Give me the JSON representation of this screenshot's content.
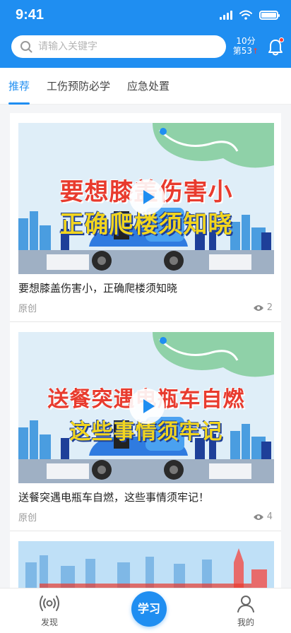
{
  "status": {
    "time": "9:41"
  },
  "header": {
    "search_placeholder": "请输入关键字",
    "score_line1": "10分",
    "score_line2": "第53",
    "score_arrow": "↑"
  },
  "tabs": [
    {
      "label": "推荐",
      "active": true
    },
    {
      "label": "工伤预防必学",
      "active": false
    },
    {
      "label": "应急处置",
      "active": false
    }
  ],
  "feed": [
    {
      "overlay_line1": "要想膝盖伤害小",
      "overlay_line2": "正确爬楼须知晓",
      "title": "要想膝盖伤害小，正确爬楼须知晓",
      "source": "原创",
      "views": "2"
    },
    {
      "overlay_line1": "送餐突遇电瓶车自燃",
      "overlay_line2": "这些事情须牢记",
      "title": "送餐突遇电瓶车自燃，这些事情须牢记！",
      "source": "原创",
      "views": "4"
    }
  ],
  "bottom_nav": {
    "discover": "发现",
    "study": "学习",
    "mine": "我的"
  },
  "colors": {
    "brand": "#1f8ef1",
    "badge": "#ff3b30"
  }
}
